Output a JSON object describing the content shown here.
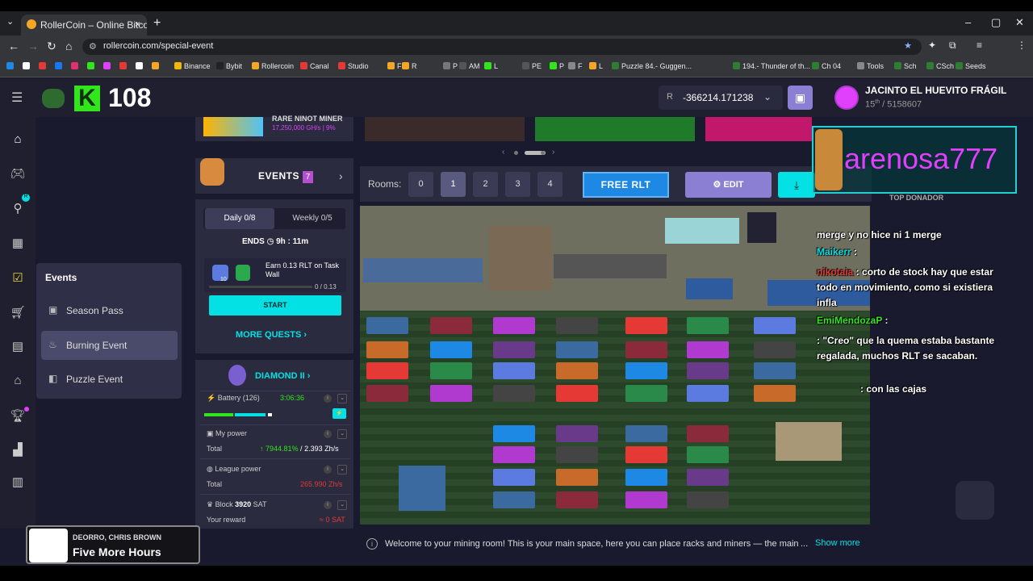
{
  "browser": {
    "tab_title": "RollerCoin – Online Bitcoin Mini",
    "url": "rollercoin.com/special-event",
    "bookmarks": [
      "Binance",
      "Bybit",
      "Rollercoin",
      "Canal",
      "Studio",
      "F",
      "R",
      "P",
      "AM",
      "L",
      "PE",
      "P",
      "F",
      "L",
      "Puzzle 84.- Guggen...",
      "194.- Thunder of th...",
      "Ch 04",
      "Tools",
      "Sch",
      "CSch",
      "Seeds"
    ]
  },
  "header": {
    "level": "108",
    "balance": "-366214.171238",
    "balance_currency": "R",
    "username": "JACINTO EL HUEVITO FRÁGIL",
    "rank": "15",
    "rank_suffix": "th",
    "rank_total": "/ 5158607"
  },
  "flyout": {
    "title": "Events",
    "items": [
      {
        "label": "Season Pass",
        "icon": "ticket-icon"
      },
      {
        "label": "Burning Event",
        "icon": "flame-icon"
      },
      {
        "label": "Puzzle Event",
        "icon": "puzzle-icon"
      }
    ]
  },
  "left": {
    "banner_title": "RARE NINOT MINER",
    "banner_power": "17,250,000 GH/s | 9%",
    "events_title": "EVENTS",
    "events_count": "7",
    "daily": "Daily 0/8",
    "weekly": "Weekly 0/5",
    "ends_label": "ENDS",
    "ends_time": "9h : 11m",
    "task_text": "Earn 0.13 RLT on Task Wall",
    "task_icon_num": "10",
    "task_progress": "0 / 0.13",
    "start": "START",
    "more_quests": "MORE QUESTS",
    "league": "DIAMOND II",
    "battery_label": "Battery (126)",
    "battery_time": "3:06:36",
    "battery_fill": 0.45,
    "my_power": "My power",
    "total": "Total",
    "my_power_pct": "↑ 7944.81%",
    "my_power_val": "2.393 Zh/s",
    "league_power": "League power",
    "league_power_val": "265.990 Zh/s",
    "block_label": "Block",
    "block_num": "3920",
    "block_unit": "SAT",
    "reward_label": "Your reward",
    "reward_val": "≈ 0 SAT"
  },
  "main": {
    "rooms_label": "Rooms:",
    "rooms": [
      "0",
      "1",
      "2",
      "3",
      "4"
    ],
    "active_room": "1",
    "free_rlt": "FREE RLT",
    "edit": "EDIT",
    "welcome": "Welcome to your mining room! This is your main space, here you can place racks and miners — the main",
    "ellipsis": "...",
    "show_more": "Show more"
  },
  "overlay": {
    "streamer": "arenosa777",
    "donor": "TOP DONADOR",
    "chat": [
      {
        "user": "",
        "text": "merge y no hice ni 1 merge"
      },
      {
        "user": "Maikerr",
        "text": ":"
      },
      {
        "user": "nikotaia",
        "text": ": corto de stock hay que estar todo en movimiento, como si existiera infla"
      },
      {
        "user": "EmiMendozaP",
        "text": ":"
      },
      {
        "user": "",
        "text": ": \"Creo\" que la quema estaba bastante regalada, muchos RLT se sacaban."
      },
      {
        "user": "",
        "text": ": con las cajas"
      }
    ]
  },
  "song": {
    "artist": "DEORRO, CHRIS BROWN",
    "title": "Five More Hours"
  },
  "colors": {
    "accent": "#03e1e4",
    "purple": "#e040fb",
    "green": "#32e61c"
  }
}
